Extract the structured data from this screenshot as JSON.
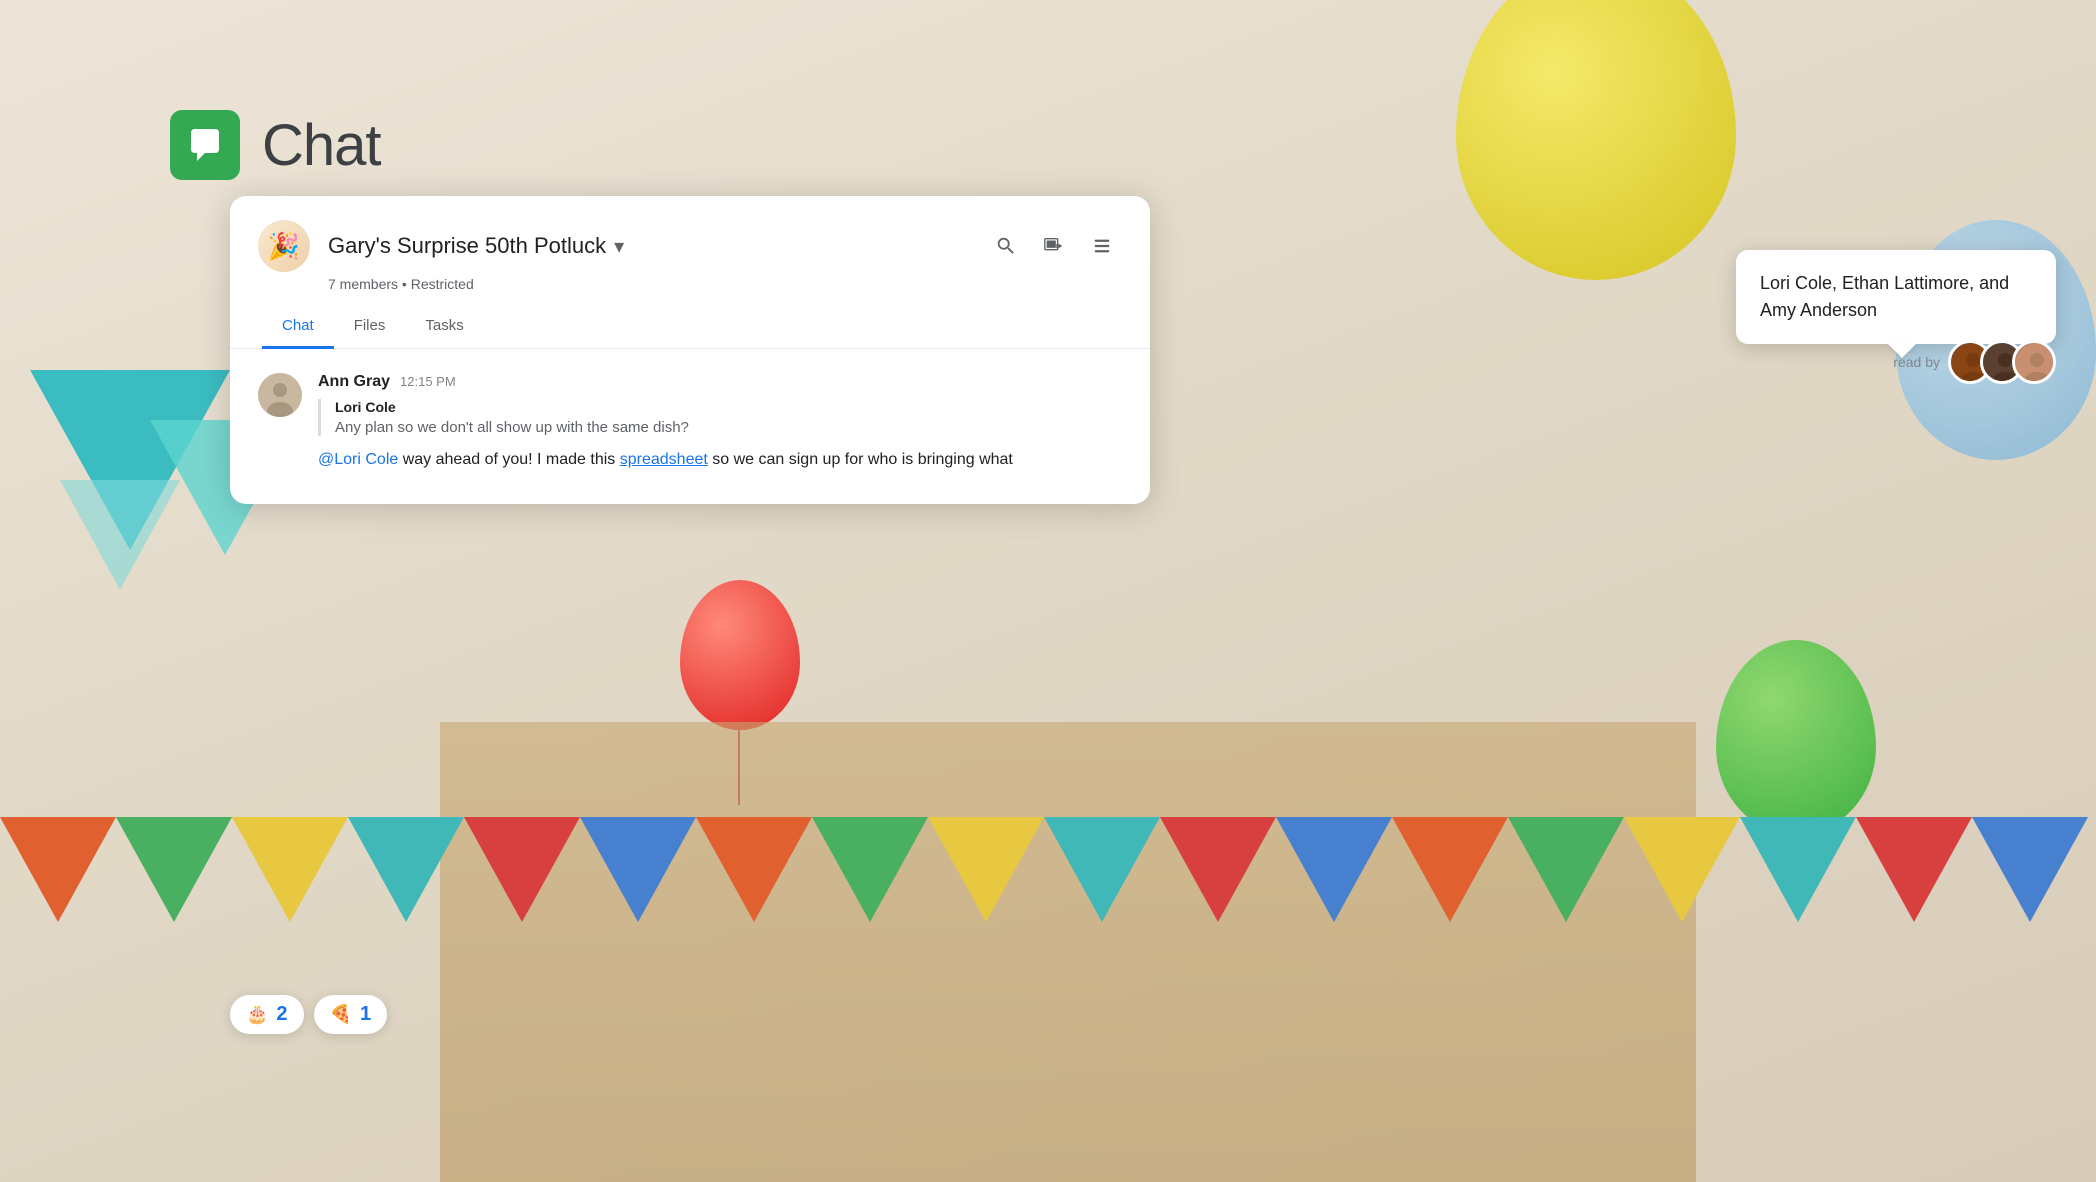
{
  "app": {
    "name": "Chat",
    "logo_color": "#34a853"
  },
  "chat_window": {
    "group_name": "Gary's Surprise 50th Potluck",
    "group_members": "7 members",
    "group_restriction": "Restricted",
    "tabs": [
      {
        "id": "chat",
        "label": "Chat",
        "active": true
      },
      {
        "id": "files",
        "label": "Files",
        "active": false
      },
      {
        "id": "tasks",
        "label": "Tasks",
        "active": false
      }
    ],
    "message": {
      "author": "Ann Gray",
      "time": "12:15 PM",
      "quoted_author": "Lori Cole",
      "quoted_text": "Any plan so we don't all show up with the same dish?",
      "mention": "@Lori Cole",
      "text_before_link": " way ahead of you! I made this ",
      "link_text": "spreadsheet",
      "text_after_link": " so we can sign up for who is bringing what"
    },
    "reactions": [
      {
        "emoji": "🎂",
        "count": "2"
      },
      {
        "emoji": "🍕",
        "count": "1"
      }
    ],
    "read_by_label": "read by"
  },
  "tooltip": {
    "text": "Lori Cole, Ethan Lattimore, and Amy Anderson"
  },
  "icons": {
    "search": "🔍",
    "video": "⬛",
    "menu": "☰",
    "chevron": "▾"
  }
}
